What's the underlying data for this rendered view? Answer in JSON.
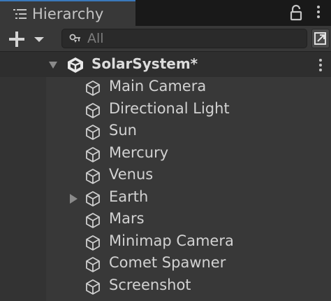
{
  "window": {
    "tab_title": "Hierarchy"
  },
  "toolbar": {
    "search_placeholder": "All"
  },
  "scene": {
    "name": "SolarSystem*"
  },
  "objects": [
    {
      "name": "Main Camera",
      "expandable": false
    },
    {
      "name": "Directional Light",
      "expandable": false
    },
    {
      "name": "Sun",
      "expandable": false
    },
    {
      "name": "Mercury",
      "expandable": false
    },
    {
      "name": "Venus",
      "expandable": false
    },
    {
      "name": "Earth",
      "expandable": true
    },
    {
      "name": "Mars",
      "expandable": false
    },
    {
      "name": "Minimap Camera",
      "expandable": false
    },
    {
      "name": "Comet Spawner",
      "expandable": false
    },
    {
      "name": "Screenshot",
      "expandable": false
    }
  ],
  "colors": {
    "accent": "#3a79bb",
    "panel": "#383838",
    "text": "#d2d2d2"
  }
}
